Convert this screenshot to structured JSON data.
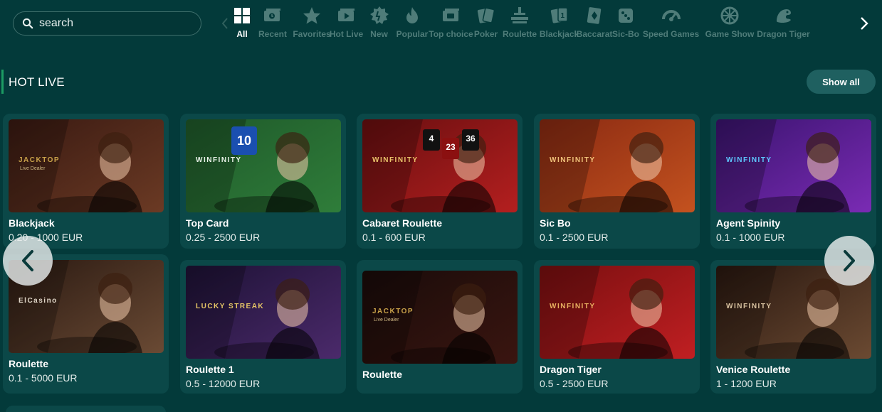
{
  "search": {
    "placeholder": "search",
    "value": "",
    "icon": "search-icon"
  },
  "categories": [
    {
      "label": "All",
      "icon": "grid-icon",
      "active": true
    },
    {
      "label": "Recent",
      "icon": "recent-icon"
    },
    {
      "label": "Favorites",
      "icon": "star-icon"
    },
    {
      "label": "Hot Live",
      "icon": "hot-live-icon"
    },
    {
      "label": "New",
      "icon": "new-badge-icon"
    },
    {
      "label": "Popular",
      "icon": "flame-icon"
    },
    {
      "label": "Top choice",
      "icon": "top-choice-icon"
    },
    {
      "label": "Poker",
      "icon": "poker-cards-icon"
    },
    {
      "label": "Roulette",
      "icon": "roulette-icon"
    },
    {
      "label": "Blackjack",
      "icon": "blackjack-icon"
    },
    {
      "label": "Baccarat",
      "icon": "baccarat-icon"
    },
    {
      "label": "Sic-Bo",
      "icon": "dice-icon"
    },
    {
      "label": "Speed Games",
      "icon": "speedometer-icon"
    },
    {
      "label": "Game Show",
      "icon": "wheel-icon"
    },
    {
      "label": "Dragon Tiger",
      "icon": "dragon-icon"
    }
  ],
  "section": {
    "title": "HOT LIVE",
    "show_all": "Show all"
  },
  "games": [
    {
      "name": "Blackjack",
      "limits": "0.20 - 1000 EUR",
      "logo": "JACKTOP",
      "logo_sub": "Live Dealer",
      "bg": [
        "#3a1a12",
        "#6b3a24"
      ],
      "accent": "#c9a24a",
      "numbers": []
    },
    {
      "name": "Top Card",
      "limits": "0.25 - 2500 EUR",
      "logo": "WINFINITY",
      "bg": [
        "#1f5a2a",
        "#2f7d3a"
      ],
      "accent": "#e9f3e9",
      "numbers": [
        "10"
      ]
    },
    {
      "name": "Cabaret Roulette",
      "limits": "0.1 - 600 EUR",
      "logo": "WINFINITY",
      "bg": [
        "#6a0f10",
        "#b41f1f"
      ],
      "accent": "#e8c26a",
      "numbers": [
        "4",
        "23",
        "36"
      ]
    },
    {
      "name": "Sic Bo",
      "limits": "0.1 - 2500 EUR",
      "logo": "WINFINITY",
      "bg": [
        "#8a2a12",
        "#c4521f"
      ],
      "accent": "#f0c27a",
      "numbers": []
    },
    {
      "name": "Agent Spinity",
      "limits": "0.1 - 1000 EUR",
      "logo": "WINFINITY",
      "bg": [
        "#3b1470",
        "#7a2bb4"
      ],
      "accent": "#5ec8ff",
      "numbers": []
    },
    {
      "name": "Roulette",
      "limits": "0.1 - 5000 EUR",
      "logo": "ElCasino",
      "bg": [
        "#2b1a12",
        "#6a4a34"
      ],
      "accent": "#e0d6c8",
      "numbers": []
    },
    {
      "name": "Roulette 1",
      "limits": "0.5 - 12000 EUR",
      "logo": "LUCKY STREAK",
      "bg": [
        "#1e1236",
        "#4b2a6b"
      ],
      "accent": "#e7c766",
      "numbers": []
    },
    {
      "name": "Roulette",
      "limits": "",
      "logo": "JACKTOP",
      "logo_sub": "Live Dealer",
      "bg": [
        "#1a0c0a",
        "#3a1510"
      ],
      "accent": "#c9a24a",
      "numbers": []
    },
    {
      "name": "Dragon Tiger",
      "limits": "0.5 - 2500 EUR",
      "logo": "WINFINITY",
      "bg": [
        "#7a0f10",
        "#c01f22"
      ],
      "accent": "#e8b060",
      "numbers": []
    },
    {
      "name": "Venice Roulette",
      "limits": "1 - 1200 EUR",
      "logo": "WINFINITY",
      "bg": [
        "#2a1810",
        "#6b4a32"
      ],
      "accent": "#d8c2a0",
      "numbers": []
    }
  ],
  "carousel": {
    "prev_icon": "chevron-left-icon",
    "next_icon": "chevron-right-icon"
  },
  "colors": {
    "page_bg": "#033a3a",
    "card_bg": "#0b4848",
    "accent_green": "#1c9c63",
    "muted_label": "#4f7c79"
  }
}
